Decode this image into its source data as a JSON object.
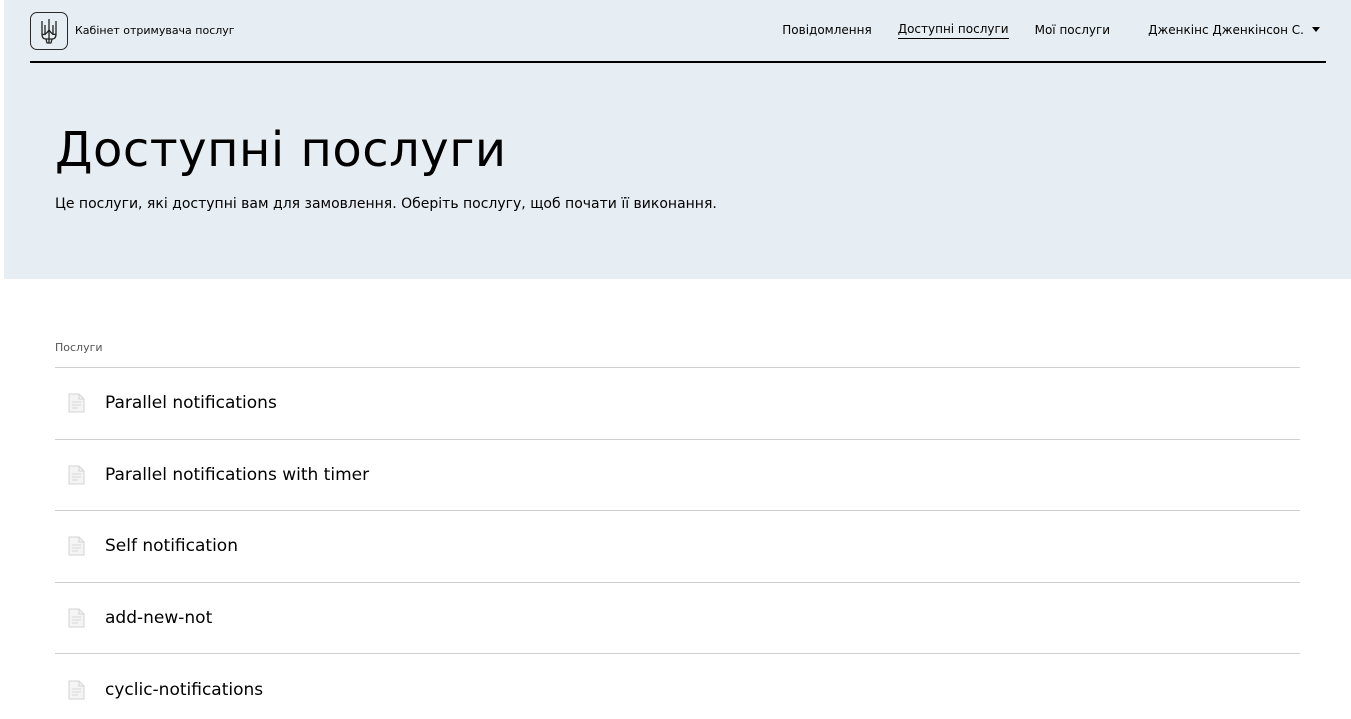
{
  "header": {
    "logo_icon": "trident-icon",
    "title": "Кабінет отримувача послуг",
    "nav": [
      {
        "label": "Повідомлення",
        "active": false
      },
      {
        "label": "Доступні послуги",
        "active": true
      },
      {
        "label": "Мої послуги",
        "active": false
      }
    ],
    "user_name": "Дженкінс Дженкінсон С."
  },
  "hero": {
    "title": "Доступні послуги",
    "subtitle": "Це послуги, які доступні вам для замовлення. Оберіть послугу, щоб почати її виконання."
  },
  "services": {
    "label": "Послуги",
    "items": [
      {
        "name": "Parallel notifications",
        "icon": "document-icon"
      },
      {
        "name": "Parallel notifications with timer",
        "icon": "document-icon"
      },
      {
        "name": "Self notification",
        "icon": "document-icon"
      },
      {
        "name": "add-new-not",
        "icon": "document-icon"
      },
      {
        "name": "cyclic-notifications",
        "icon": "document-icon"
      }
    ]
  },
  "colors": {
    "hero_bg": "#e7eef3",
    "divider": "#cfcfcf",
    "text": "#000000",
    "muted": "#555555"
  }
}
